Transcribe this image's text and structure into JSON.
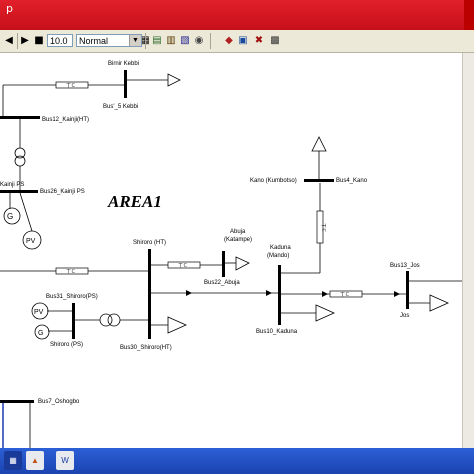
{
  "window": {
    "title_fragment": "p"
  },
  "toolbar": {
    "sim_time": "10.0",
    "sim_mode": "Normal",
    "play_icon": "play-icon",
    "stop_icon": "stop-icon"
  },
  "diagram": {
    "area_label": "AREA1",
    "labels": {
      "birnin_kebbi": "Birnir Kebbi",
      "bus_kebbi": "Bus'_5 Kebbi",
      "bus12": "Bus12_Kainji(HT)",
      "kainji_ps": "Kainji PS",
      "bus26": "Bus26_Kainji PS",
      "pv_left": "PV",
      "shiroro_ht": "Shiroro (HT)",
      "abuja": "Abuja",
      "katampe": "(Katampe)",
      "bus22": "Bus22_Abuja",
      "bus31": "Bus31_Shiroro(PS)",
      "pv_shiroro": "PV",
      "shiroro_ps": "Shiroro (PS)",
      "bus30": "Bus30_Shiroro(HT)",
      "kaduna": "Kaduna",
      "mando": "(Mando)",
      "bus10": "Bus10_Kaduna",
      "kano": "Kano (Kumbotso)",
      "bus4": "Bus4_Kano",
      "bus13": "Bus13_Jos",
      "jos": "Jos",
      "bus7": "Bus7_Oshogbo"
    }
  },
  "taskbar": {
    "items": [
      "matlab-icon",
      "word-icon"
    ]
  }
}
